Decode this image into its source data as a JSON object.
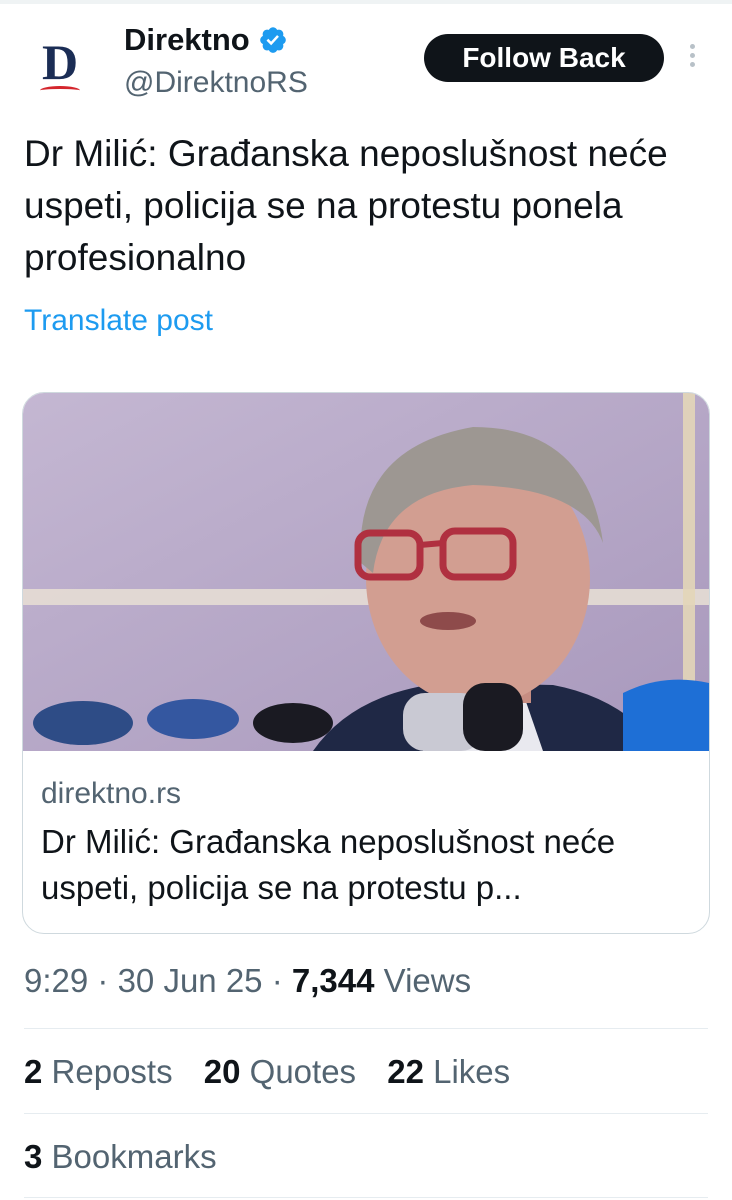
{
  "author": {
    "name": "Direktno",
    "handle": "@DirektnoRS",
    "avatar_letter": "D",
    "verified_icon": "verified-badge-icon",
    "verified_color": "#1d9bf0"
  },
  "follow_button": {
    "label": "Follow Back"
  },
  "more_icon": "more-vertical-icon",
  "tweet": {
    "text": "Dr Milić: Građanska neposlušnost neće uspeti, policija se na protestu ponela profesionalno",
    "translate_label": "Translate post"
  },
  "card": {
    "domain": "direktno.rs",
    "title": "Dr Milić: Građanska neposlušnost neće uspeti, policija se na protestu p..."
  },
  "meta": {
    "time": "9:29",
    "date": "30 Jun 25",
    "views_count": "7,344",
    "views_label": "Views"
  },
  "stats": {
    "reposts_count": "2",
    "reposts_label": "Reposts",
    "quotes_count": "20",
    "quotes_label": "Quotes",
    "likes_count": "22",
    "likes_label": "Likes",
    "bookmarks_count": "3",
    "bookmarks_label": "Bookmarks"
  },
  "colors": {
    "text": "#0f1419",
    "secondary": "#536471",
    "link": "#1d9bf0",
    "button_bg": "#0f1419"
  }
}
